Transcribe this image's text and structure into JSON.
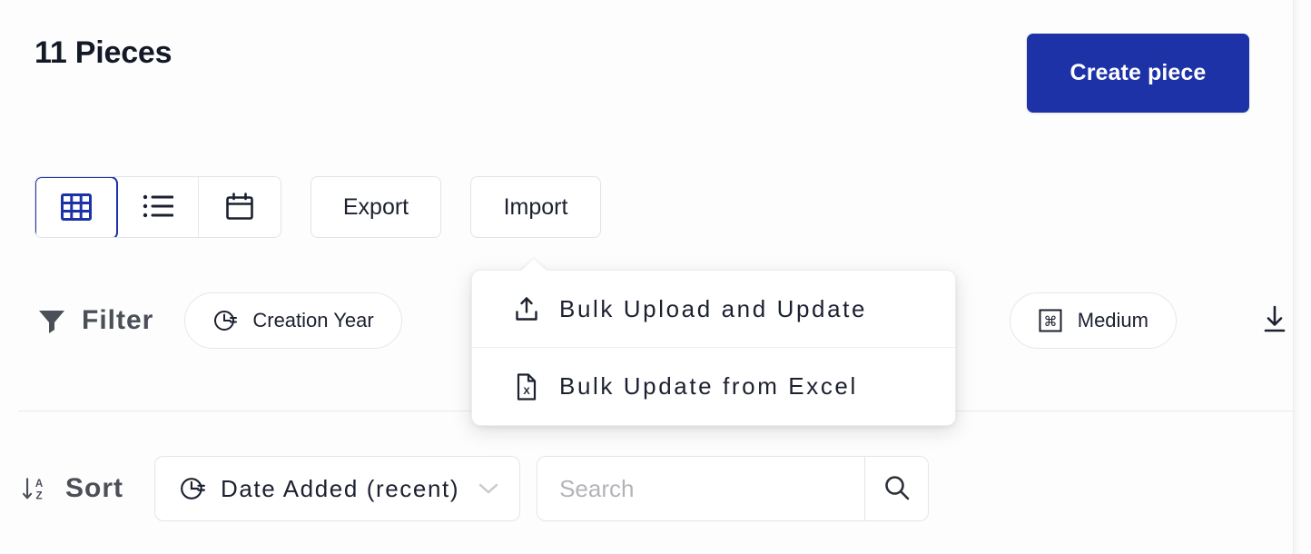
{
  "header": {
    "title": "11 Pieces",
    "create_button": "Create piece"
  },
  "toolbar": {
    "views": [
      {
        "name": "grid",
        "icon": "grid-icon",
        "active": true
      },
      {
        "name": "list",
        "icon": "list-icon",
        "active": false
      },
      {
        "name": "calendar",
        "icon": "calendar-icon",
        "active": false
      }
    ],
    "export_label": "Export",
    "import_label": "Import"
  },
  "import_menu": {
    "open": true,
    "items": [
      {
        "label": "Bulk Upload and Update",
        "icon": "upload-icon"
      },
      {
        "label": "Bulk Update from Excel",
        "icon": "excel-file-icon"
      }
    ]
  },
  "filter": {
    "label": "Filter",
    "icon": "funnel-icon",
    "chips": [
      {
        "label": "Creation Year",
        "icon": "clock-pie-icon"
      },
      {
        "label": "Medium",
        "icon": "command-square-icon"
      }
    ],
    "download_icon": "download-icon"
  },
  "sort": {
    "label": "Sort",
    "icon": "sort-az-icon",
    "selected": "Date Added (recent)",
    "select_icon": "clock-pie-icon",
    "chevron": "chevron-down-icon"
  },
  "search": {
    "value": "",
    "placeholder": "Search",
    "button_icon": "search-icon"
  },
  "colors": {
    "accent": "#1C32A6",
    "title": "#141927",
    "label": "#4B4F57",
    "border": "#E4E5E7",
    "placeholder": "#B3B4B8",
    "background": "#FDFDFD"
  }
}
